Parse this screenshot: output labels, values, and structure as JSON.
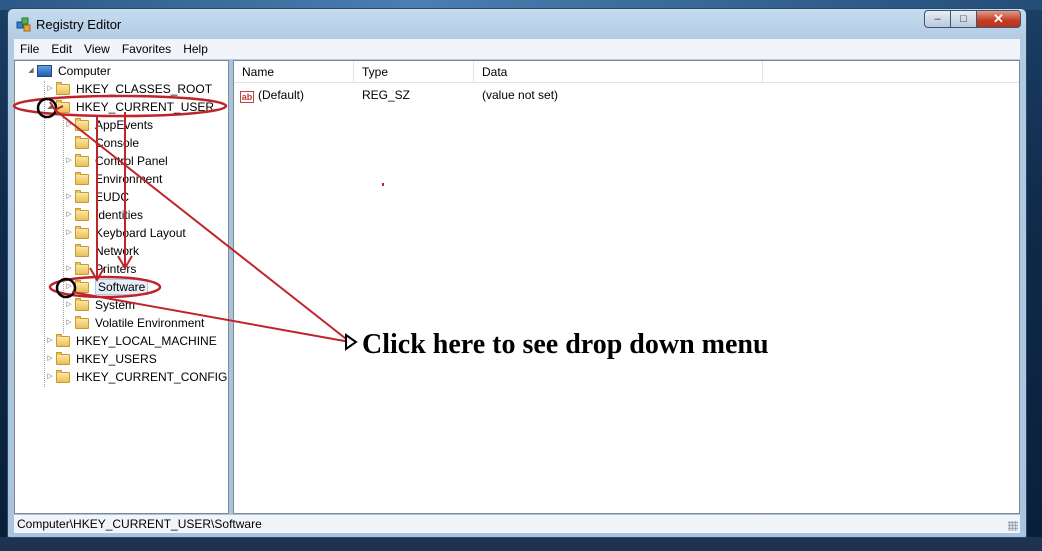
{
  "window": {
    "title": "Registry Editor",
    "controls": {
      "minimize": "–",
      "maximize": "□",
      "close": "✕"
    }
  },
  "menu": [
    "File",
    "Edit",
    "View",
    "Favorites",
    "Help"
  ],
  "tree": {
    "root": "Computer",
    "hives": [
      "HKEY_CLASSES_ROOT",
      "HKEY_CURRENT_USER",
      "HKEY_LOCAL_MACHINE",
      "HKEY_USERS",
      "HKEY_CURRENT_CONFIG"
    ],
    "current_user_children": [
      "AppEvents",
      "Console",
      "Control Panel",
      "Environment",
      "EUDC",
      "Identities",
      "Keyboard Layout",
      "Network",
      "Printers",
      "Software",
      "System",
      "Volatile Environment"
    ],
    "selected": "Software"
  },
  "list": {
    "columns": [
      "Name",
      "Type",
      "Data"
    ],
    "rows": [
      {
        "icon": "string-value-icon",
        "name": "(Default)",
        "type": "REG_SZ",
        "data": "(value not set)"
      }
    ]
  },
  "status_bar": "Computer\\HKEY_CURRENT_USER\\Software",
  "annotation": {
    "text": "Click here to see drop down menu",
    "color": "#000000",
    "marker_color": "#c0242b"
  },
  "colors": {
    "titlebar": "#b9d1ea",
    "menubar": "#f1f5fa",
    "selection": "#e5eef8",
    "close_button": "#c23b22"
  }
}
